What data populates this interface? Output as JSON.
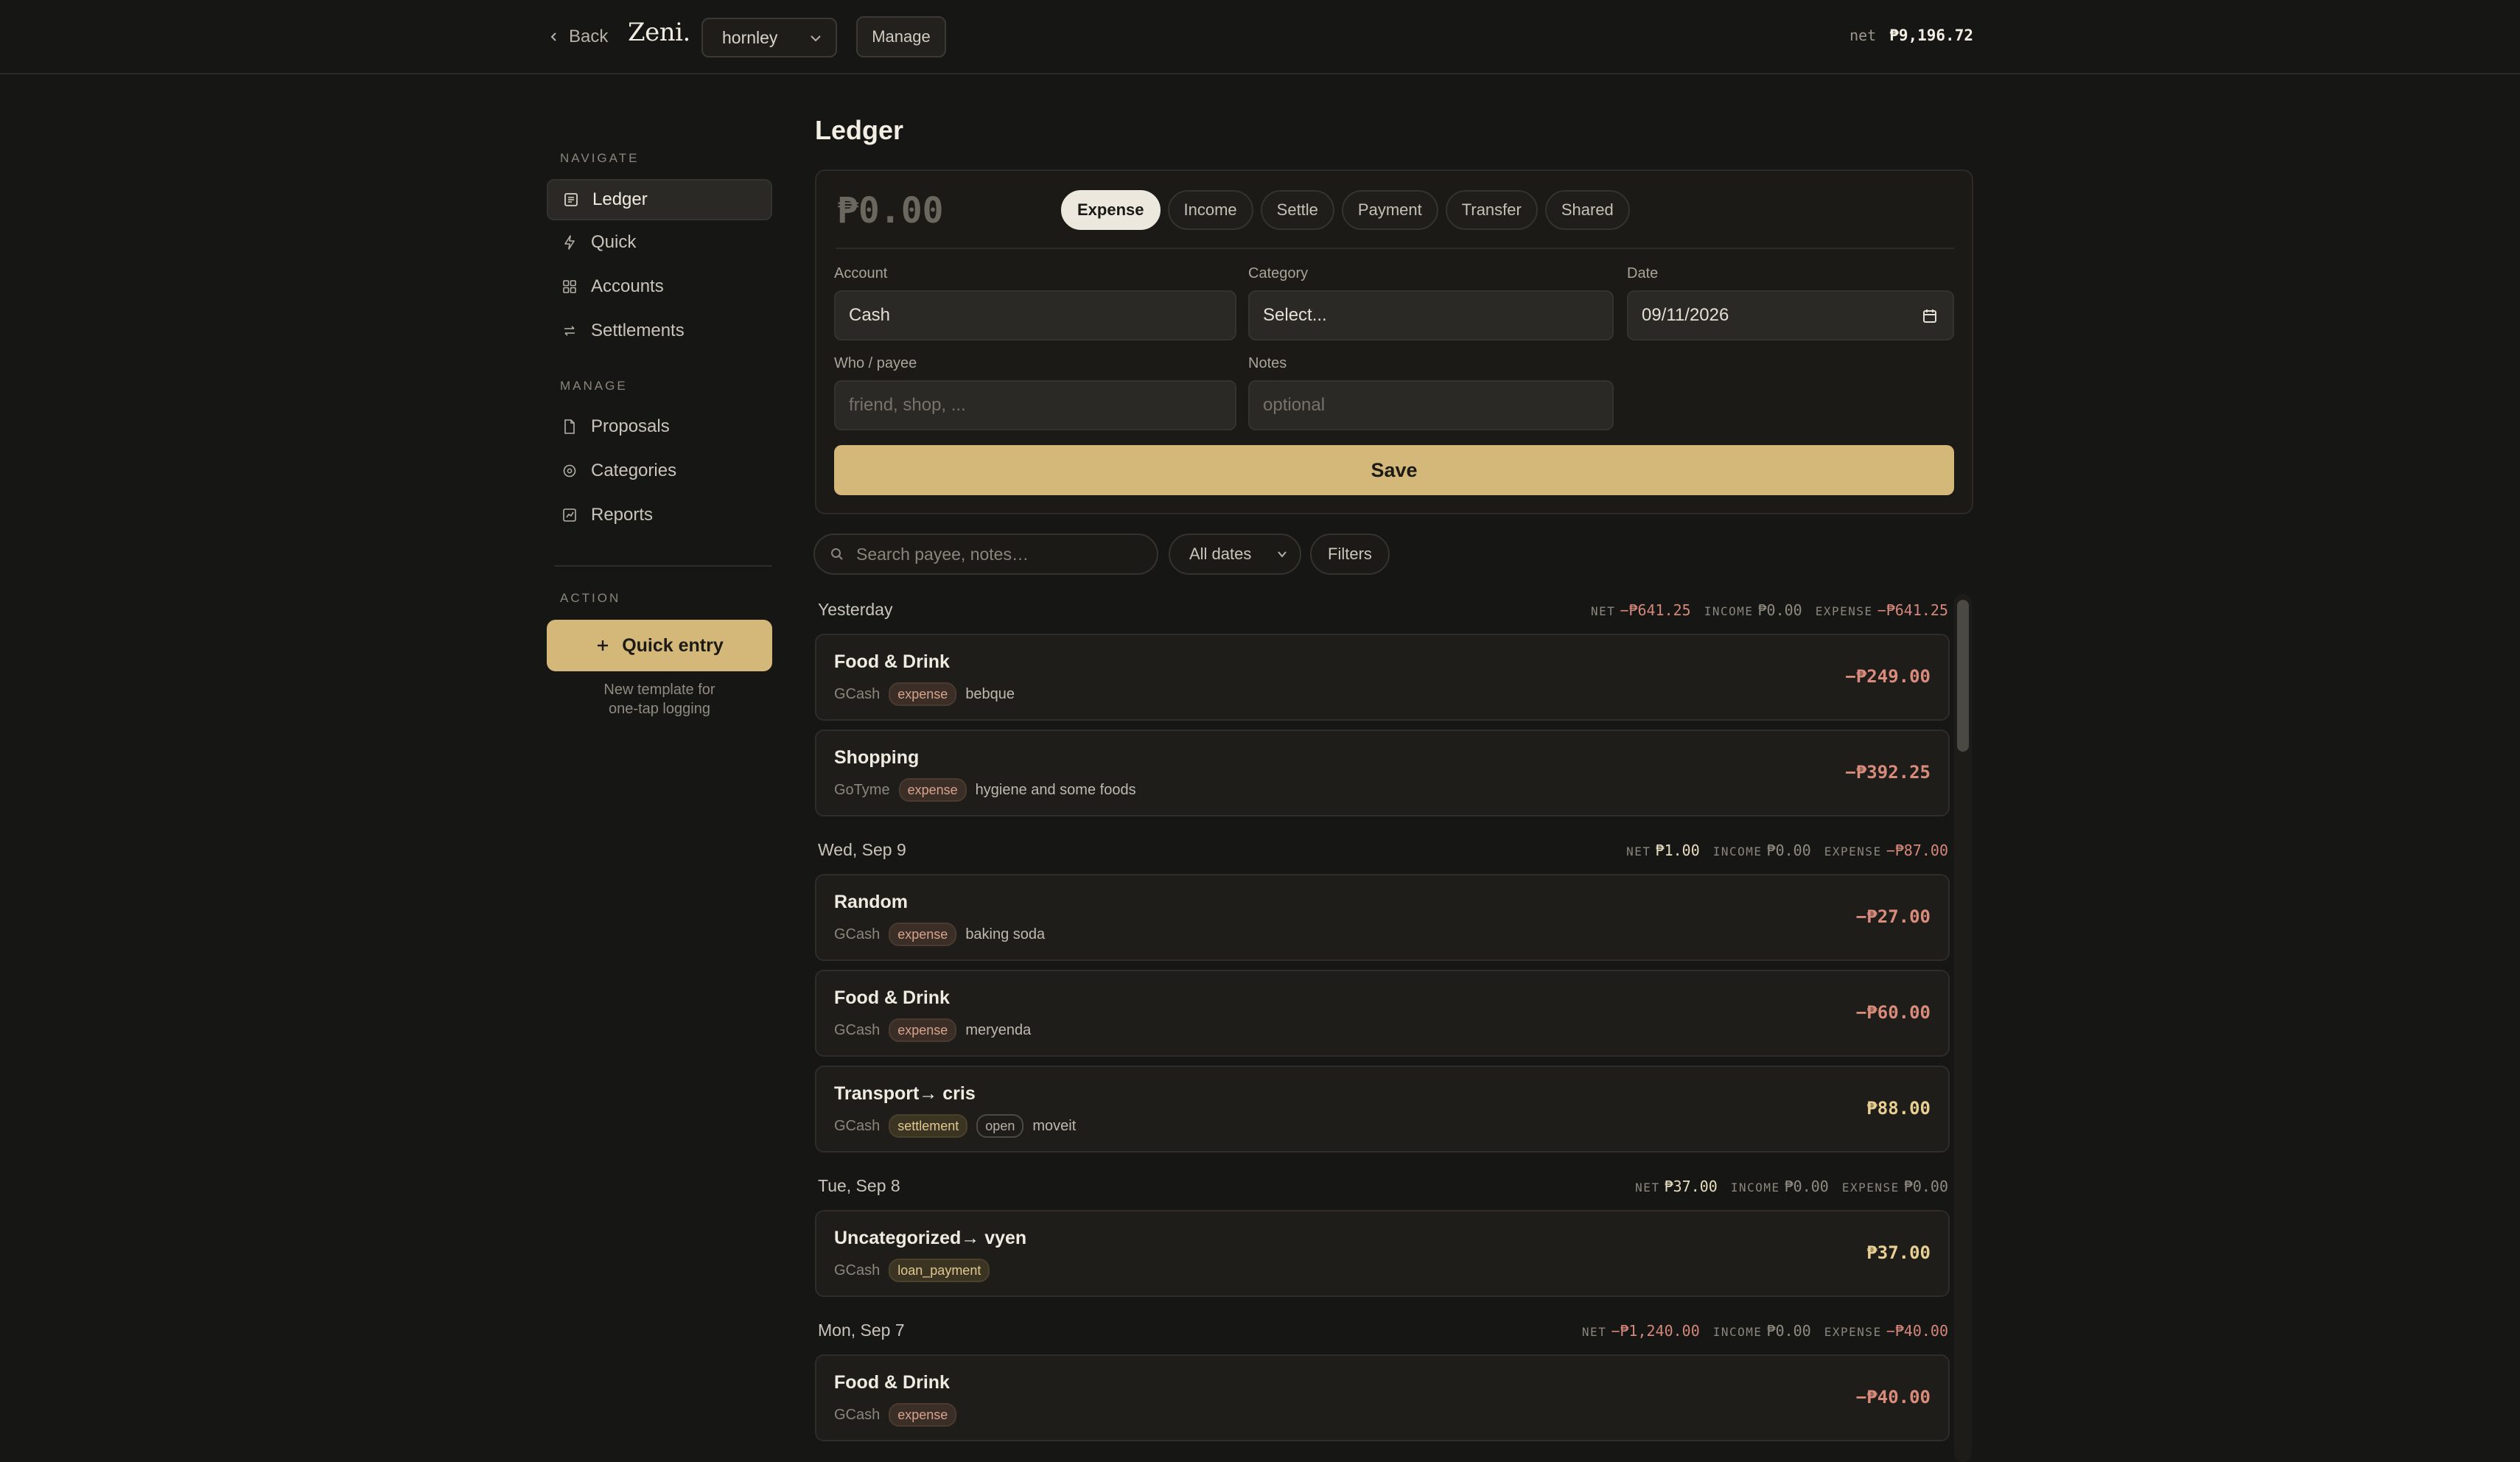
{
  "topbar": {
    "back_label": "Back",
    "logo": "Zeni.",
    "workspace": "hornley",
    "manage_label": "Manage",
    "net_label": "net",
    "net_value": "₱9,196.72"
  },
  "sidebar": {
    "navigate_heading": "NAVIGATE",
    "nav": [
      {
        "label": "Ledger",
        "icon": "ledger-icon"
      },
      {
        "label": "Quick",
        "icon": "bolt-icon"
      },
      {
        "label": "Accounts",
        "icon": "grid-icon"
      },
      {
        "label": "Settlements",
        "icon": "transfer-icon"
      }
    ],
    "manage_heading": "MANAGE",
    "manage": [
      {
        "label": "Proposals",
        "icon": "document-icon"
      },
      {
        "label": "Categories",
        "icon": "tag-icon"
      },
      {
        "label": "Reports",
        "icon": "chart-icon"
      }
    ],
    "action_heading": "ACTION",
    "quick_entry_label": "Quick entry",
    "quick_note_line1": "New template for",
    "quick_note_line2": "one-tap logging"
  },
  "main": {
    "title": "Ledger",
    "form": {
      "amount": "₱0.00",
      "types": [
        "Expense",
        "Income",
        "Settle",
        "Payment",
        "Transfer",
        "Shared"
      ],
      "active_type": "Expense",
      "account_label": "Account",
      "account_value": "Cash",
      "category_label": "Category",
      "category_value": "Select...",
      "date_label": "Date",
      "date_value": "09/11/2026",
      "payee_label": "Who / payee",
      "payee_placeholder": "friend, shop, ...",
      "notes_label": "Notes",
      "notes_placeholder": "optional",
      "save_label": "Save"
    },
    "filters": {
      "search_placeholder": "Search payee, notes…",
      "dates_value": "All dates",
      "filters_label": "Filters"
    },
    "stat_labels": {
      "net": "NET",
      "income": "INCOME",
      "expense": "EXPENSE"
    },
    "days": [
      {
        "title": "Yesterday",
        "net": "−₱641.25",
        "income": "₱0.00",
        "expense": "−₱641.25",
        "txns": [
          {
            "title": "Food & Drink",
            "account": "GCash",
            "tags": [
              "expense"
            ],
            "note": "bebque",
            "amount": "−₱249.00"
          },
          {
            "title": "Shopping",
            "account": "GoTyme",
            "tags": [
              "expense"
            ],
            "note": "hygiene and some foods",
            "amount": "−₱392.25"
          }
        ]
      },
      {
        "title": "Wed, Sep 9",
        "net": "₱1.00",
        "income": "₱0.00",
        "expense": "−₱87.00",
        "txns": [
          {
            "title": "Random",
            "account": "GCash",
            "tags": [
              "expense"
            ],
            "note": "baking soda",
            "amount": "−₱27.00"
          },
          {
            "title": "Food & Drink",
            "account": "GCash",
            "tags": [
              "expense"
            ],
            "note": "meryenda",
            "amount": "−₱60.00"
          },
          {
            "title": "Transport→ cris",
            "account": "GCash",
            "tags": [
              "settlement",
              "open"
            ],
            "note": "moveit",
            "amount": "₱88.00"
          }
        ]
      },
      {
        "title": "Tue, Sep 8",
        "net": "₱37.00",
        "income": "₱0.00",
        "expense": "₱0.00",
        "txns": [
          {
            "title": "Uncategorized→ vyen",
            "account": "GCash",
            "tags": [
              "loan_payment"
            ],
            "note": "",
            "amount": "₱37.00"
          }
        ]
      },
      {
        "title": "Mon, Sep 7",
        "net": "−₱1,240.00",
        "income": "₱0.00",
        "expense": "−₱40.00",
        "txns": [
          {
            "title": "Food & Drink",
            "account": "GCash",
            "tags": [
              "expense"
            ],
            "note": "",
            "amount": "−₱40.00"
          }
        ]
      }
    ]
  }
}
